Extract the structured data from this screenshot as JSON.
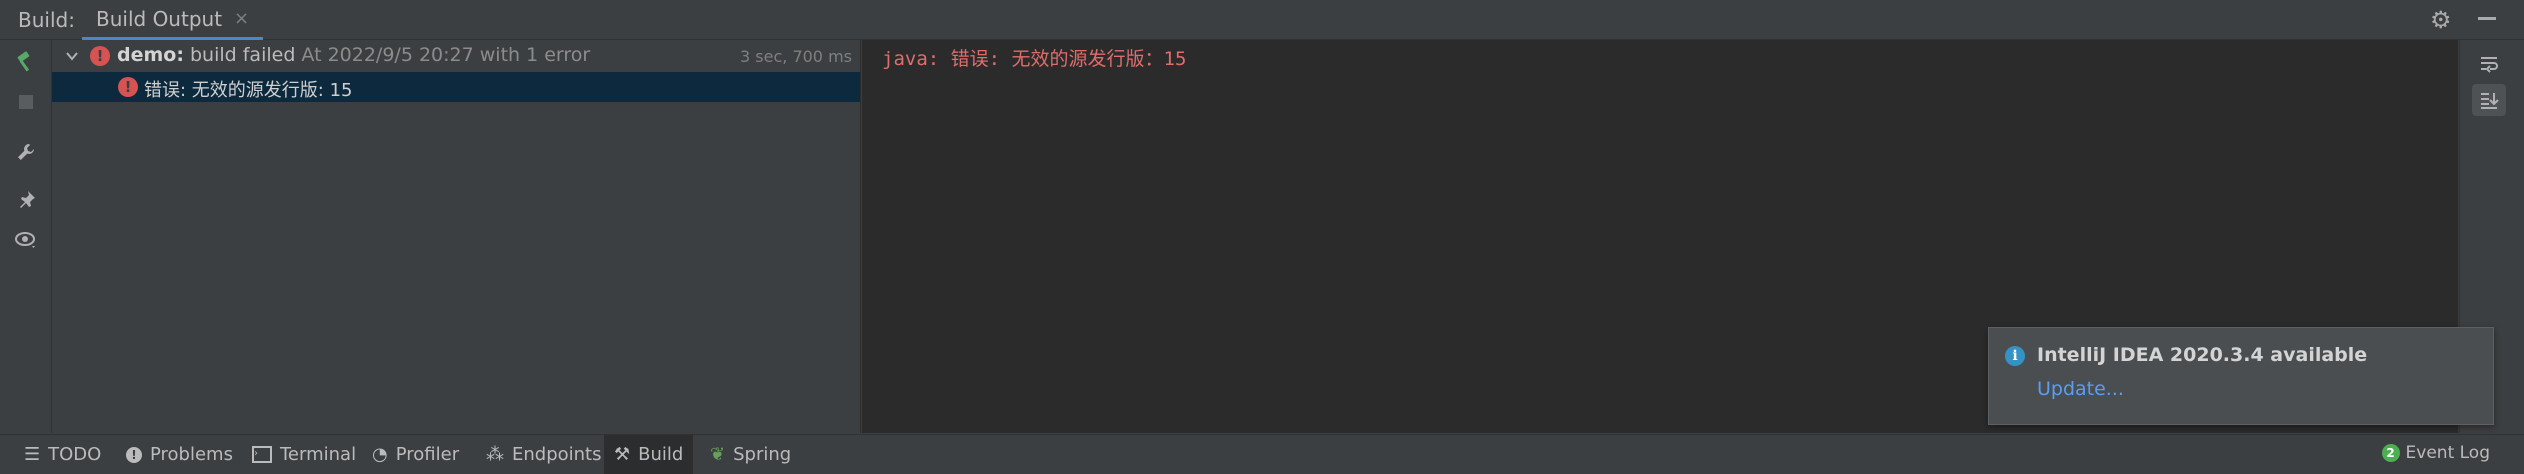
{
  "toolwindow": {
    "title": "Build:",
    "tab_label": "Build Output",
    "tab_close": "×"
  },
  "tree": {
    "root": {
      "project": "demo:",
      "status": " build failed",
      "detail": " At 2022/9/5 20:27 with 1 error",
      "timing": "3 sec, 700 ms"
    },
    "child": {
      "message": "错误: 无效的源发行版: 15"
    }
  },
  "console": {
    "line": "java: 错误: 无效的源发行版：15"
  },
  "notification": {
    "title": "IntelliJ IDEA 2020.3.4 available",
    "link": "Update..."
  },
  "statusbar": {
    "items": [
      {
        "label": "TODO",
        "icon": "list-icon"
      },
      {
        "label": "Problems",
        "icon": "problems-icon"
      },
      {
        "label": "Terminal",
        "icon": "terminal-icon"
      },
      {
        "label": "Profiler",
        "icon": "profiler-icon"
      },
      {
        "label": "Endpoints",
        "icon": "endpoints-icon"
      },
      {
        "label": "Build",
        "icon": "hammer-icon",
        "active": true
      },
      {
        "label": "Spring",
        "icon": "spring-icon"
      }
    ],
    "event_log": "Event Log",
    "event_log_badge": "2"
  },
  "colors": {
    "accent": "#4a88c7",
    "error": "#d65353",
    "console_error": "#e06c6c",
    "link": "#589df6",
    "selection": "#0d293e"
  }
}
